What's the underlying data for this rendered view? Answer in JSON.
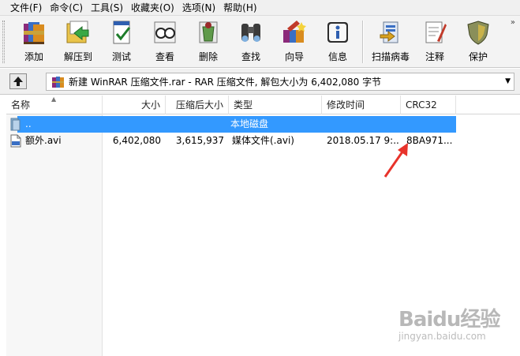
{
  "menu": {
    "items": [
      "文件(F)",
      "命令(C)",
      "工具(S)",
      "收藏夹(O)",
      "选项(N)",
      "帮助(H)"
    ]
  },
  "toolbar": {
    "buttons": [
      {
        "label": "添加",
        "icon": "add-archive-icon"
      },
      {
        "label": "解压到",
        "icon": "extract-to-icon"
      },
      {
        "label": "测试",
        "icon": "test-icon"
      },
      {
        "label": "查看",
        "icon": "view-icon"
      },
      {
        "label": "删除",
        "icon": "delete-icon"
      },
      {
        "label": "查找",
        "icon": "find-binoculars-icon"
      },
      {
        "label": "向导",
        "icon": "wizard-icon"
      },
      {
        "label": "信息",
        "icon": "info-icon"
      },
      {
        "label": "扫描病毒",
        "icon": "virus-scan-icon"
      },
      {
        "label": "注释",
        "icon": "comment-icon"
      },
      {
        "label": "保护",
        "icon": "protect-shield-icon"
      }
    ],
    "more": "»"
  },
  "address": {
    "path": "新建 WinRAR 压缩文件.rar - RAR 压缩文件, 解包大小为 6,402,080 字节"
  },
  "columns": {
    "name": "名称",
    "size": "大小",
    "packed": "压缩后大小",
    "type": "类型",
    "modified": "修改时间",
    "crc": "CRC32"
  },
  "rows": [
    {
      "name": "..",
      "size": "",
      "packed": "",
      "type": "本地磁盘",
      "modified": "",
      "crc": "",
      "selected": true
    },
    {
      "name": "额外.avi",
      "size": "6,402,080",
      "packed": "3,615,937",
      "type": "媒体文件(.avi)",
      "modified": "2018.05.17 9:...",
      "crc": "8BA971...",
      "selected": false
    }
  ],
  "watermark": {
    "brand": "Baidu经验",
    "url": "jingyan.baidu.com"
  },
  "colors": {
    "selection": "#3399ff",
    "annotation_arrow": "#e8332b"
  }
}
